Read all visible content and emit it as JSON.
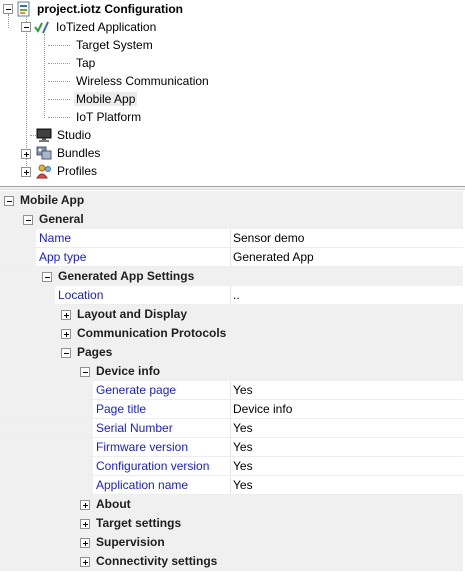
{
  "tree": {
    "root": {
      "label": "project.iotz Configuration",
      "icon": "config-file-icon"
    },
    "iotized": {
      "label": "IoTized Application",
      "icon": "check-pencil-icon"
    },
    "children": [
      {
        "label": "Target System"
      },
      {
        "label": "Tap"
      },
      {
        "label": "Wireless Communication"
      },
      {
        "label": "Mobile App",
        "selected": true
      },
      {
        "label": "IoT Platform"
      }
    ],
    "studio": {
      "label": "Studio",
      "icon": "monitor-icon"
    },
    "bundles": {
      "label": "Bundles",
      "icon": "bundles-icon"
    },
    "profiles": {
      "label": "Profiles",
      "icon": "profiles-icon"
    }
  },
  "grid": {
    "mobile_app": "Mobile App",
    "general": "General",
    "name": {
      "label": "Name",
      "value": "Sensor demo"
    },
    "app_type": {
      "label": "App type",
      "value": "Generated App"
    },
    "generated_settings": "Generated App Settings",
    "location": {
      "label": "Location",
      "value": ".."
    },
    "layout_display": "Layout and Display",
    "comm_protocols": "Communication Protocols",
    "pages": "Pages",
    "device_info": "Device info",
    "device_props": [
      {
        "label": "Generate page",
        "value": "Yes"
      },
      {
        "label": "Page title",
        "value": "Device info"
      },
      {
        "label": "Serial Number",
        "value": "Yes"
      },
      {
        "label": "Firmware version",
        "value": "Yes"
      },
      {
        "label": "Configuration version",
        "value": "Yes"
      },
      {
        "label": "Application name",
        "value": "Yes"
      }
    ],
    "about": "About",
    "target_settings": "Target settings",
    "supervision": "Supervision",
    "connectivity_settings": "Connectivity settings"
  },
  "colors": {
    "property_name": "#1c22c8",
    "band": "#f0f0f0"
  }
}
